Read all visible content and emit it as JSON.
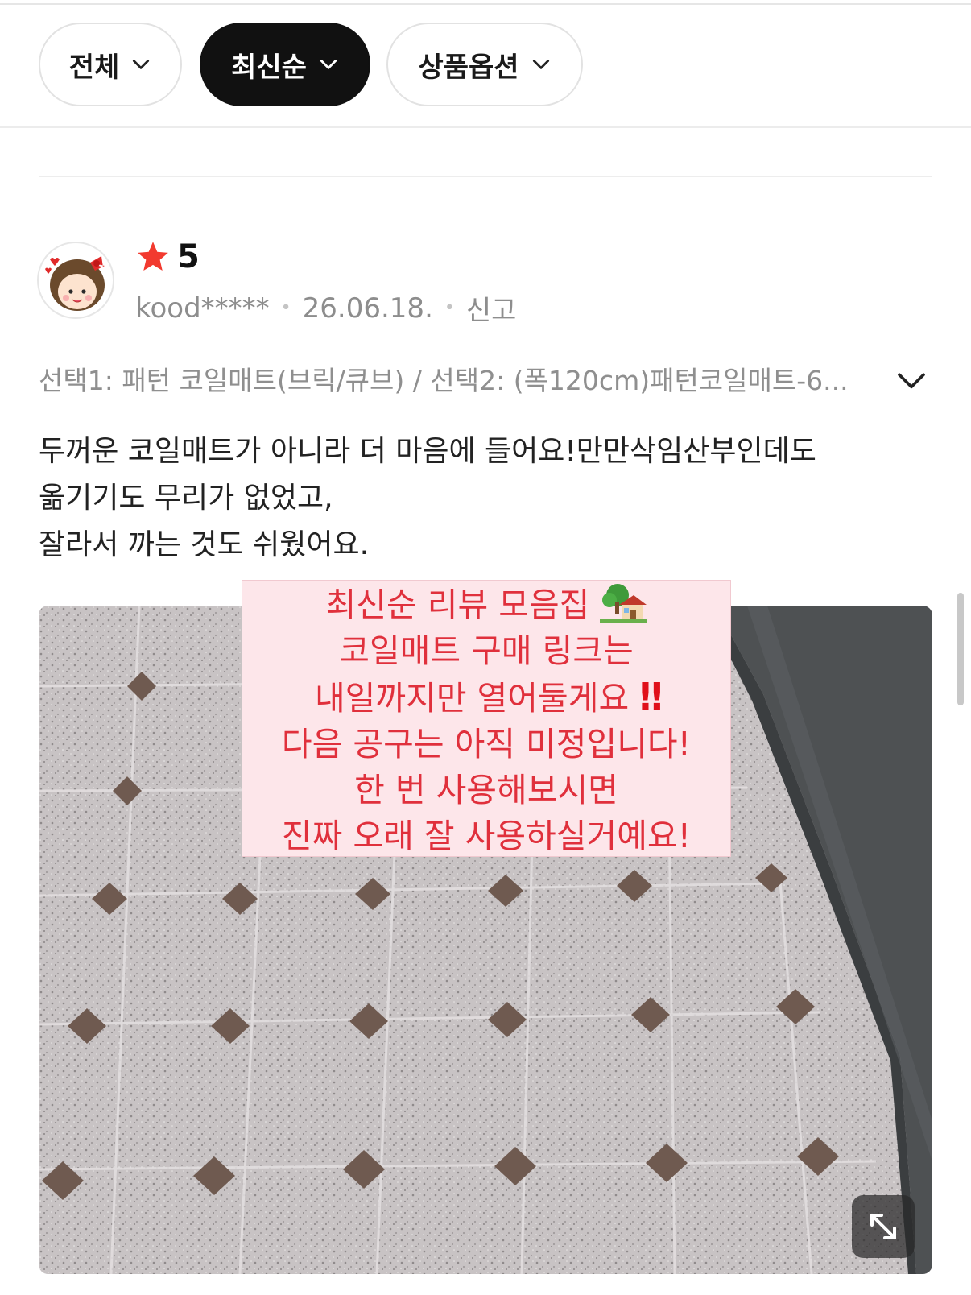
{
  "filters": [
    {
      "label": "전체",
      "active": false
    },
    {
      "label": "최신순",
      "active": true
    },
    {
      "label": "상품옵션",
      "active": false
    }
  ],
  "review": {
    "rating_value": "5",
    "user": "kood*****",
    "date": "26.06.18.",
    "report_label": "신고",
    "option_text": "선택1: 패턴 코일매트(브릭/큐브) / 선택2: (폭120cm)패턴코일매트-6...",
    "text_lines": [
      "두꺼운 코일매트가 아니라 더 마음에 들어요!만만삭임산부인데도",
      "옮기기도 무리가 없었고,",
      "잘라서 까는 것도 쉬웠어요."
    ]
  },
  "notice": {
    "line1": "최신순 리뷰 모음집",
    "line2": "코일매트 구매 링크는",
    "line3": "내일까지만 열어둘게요",
    "line3_emoji": "‼",
    "line4": "다음 공구는 아직 미정입니다!",
    "line5": "한 번 사용해보시면",
    "line6": "진짜 오래 잘 사용하실거예요!"
  },
  "icons": {
    "filter_chevron": "chevron-down-icon",
    "star": "star-icon",
    "option_expand": "chevron-down-icon",
    "photo_expand": "expand-icon",
    "house": "house-with-garden-emoji"
  },
  "colors": {
    "star": "#f23a2f",
    "notice_text": "#e0303c",
    "notice_bg": "#fde6ea",
    "active_chip": "#111111"
  }
}
